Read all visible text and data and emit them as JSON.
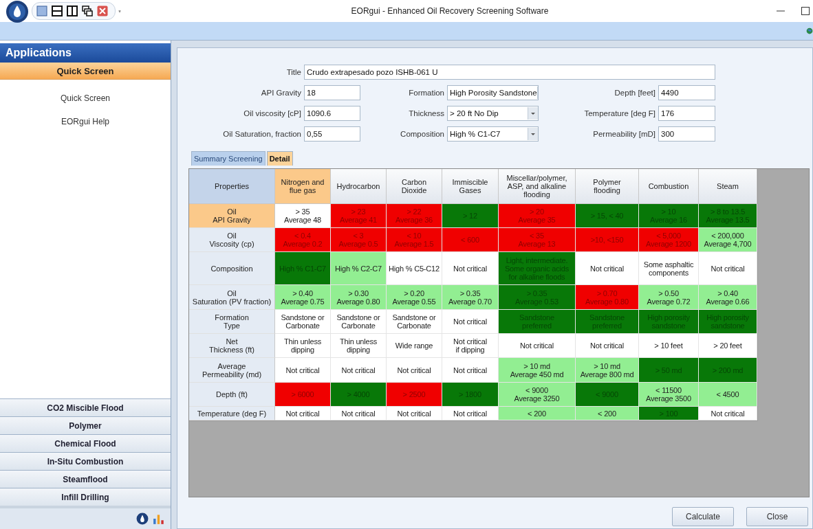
{
  "window": {
    "title": "EORgui - Enhanced Oil Recovery Screening Software"
  },
  "sidebar": {
    "header": "Applications",
    "section": {
      "label": "Quick Screen",
      "selected": true
    },
    "items": [
      "Quick Screen",
      "EORgui Help"
    ],
    "groups": [
      {
        "label": "CO2 Miscible Flood",
        "selected": false
      },
      {
        "label": "Polymer",
        "selected": false
      },
      {
        "label": "Chemical Flood",
        "selected": false
      },
      {
        "label": "In-Situ Combustion",
        "selected": false
      },
      {
        "label": "Steamflood",
        "selected": false
      },
      {
        "label": "Infill Drilling",
        "selected": false
      }
    ]
  },
  "form": {
    "title": {
      "label": "Title",
      "value": "Crudo extrapesado pozo ISHB-061 U"
    },
    "fields": [
      {
        "label": "API Gravity",
        "value": "18",
        "kind": "text"
      },
      {
        "label": "Formation",
        "value": "High Porosity Sandstone",
        "kind": "dropdown"
      },
      {
        "label": "Depth [feet]",
        "value": "4490",
        "kind": "text"
      },
      {
        "label": "Oil viscosity [cP]",
        "value": "1090.6",
        "kind": "text"
      },
      {
        "label": "Thickness",
        "value": "> 20 ft No Dip",
        "kind": "dropdown"
      },
      {
        "label": "Temperature [deg F]",
        "value": "176",
        "kind": "text"
      },
      {
        "label": "Oil Saturation, fraction",
        "value": "0,55",
        "kind": "text"
      },
      {
        "label": "Composition",
        "value": "High % C1-C7",
        "kind": "dropdown"
      },
      {
        "label": "Permeability [mD]",
        "value": "300",
        "kind": "text"
      }
    ]
  },
  "tabs": [
    {
      "label": "Summary Screening",
      "selected": false
    },
    {
      "label": "Detail",
      "selected": true
    }
  ],
  "table": {
    "corner": "Properties",
    "columns": [
      {
        "label": "Nitrogen and\nflue gas",
        "highlighted": true
      },
      {
        "label": "Hydrocarbon",
        "highlighted": false
      },
      {
        "label": "Carbon\nDioxide",
        "highlighted": false
      },
      {
        "label": "Immiscible\nGases",
        "highlighted": false
      },
      {
        "label": "Miscellar/polymer,\nASP, and alkaline\nflooding",
        "highlighted": false
      },
      {
        "label": "Polymer\nflooding",
        "highlighted": false
      },
      {
        "label": "Combustion",
        "highlighted": false
      },
      {
        "label": "Steam",
        "highlighted": false
      }
    ],
    "rows": [
      {
        "label": "Oil\nAPI Gravity",
        "highlighted": true,
        "cells": [
          {
            "text": "> 35\nAverage 48",
            "color": "#ffffff"
          },
          {
            "text": "> 23\nAverage 41",
            "color": "#f00000"
          },
          {
            "text": "> 22\nAverage 36",
            "color": "#f00000"
          },
          {
            "text": "> 12",
            "color": "#087808"
          },
          {
            "text": "> 20\nAverage 35",
            "color": "#f00000"
          },
          {
            "text": "> 15, < 40",
            "color": "#087808"
          },
          {
            "text": "> 10\nAverage 16",
            "color": "#087808"
          },
          {
            "text": "> 8 to 13.5\nAverage 13.5",
            "color": "#087808"
          }
        ]
      },
      {
        "label": "Oil\nViscosity (cp)",
        "highlighted": false,
        "cells": [
          {
            "text": "< 0.4\nAverage 0.2",
            "color": "#f00000"
          },
          {
            "text": "< 3\nAverage 0.5",
            "color": "#f00000"
          },
          {
            "text": "< 10\nAverage 1.5",
            "color": "#f00000"
          },
          {
            "text": "< 600",
            "color": "#f00000"
          },
          {
            "text": "< 35\nAverage 13",
            "color": "#f00000"
          },
          {
            "text": ">10, <150",
            "color": "#f00000"
          },
          {
            "text": "< 5,000\nAverage 1200",
            "color": "#f00000"
          },
          {
            "text": "< 200,000\nAverage 4,700",
            "color": "#92ee92"
          }
        ]
      },
      {
        "label": "Composition",
        "highlighted": false,
        "cells": [
          {
            "text": "High % C1-C7",
            "color": "#087808"
          },
          {
            "text": "High % C2-C7",
            "color": "#92ee92"
          },
          {
            "text": "High % C5-C12",
            "color": "#ffffff"
          },
          {
            "text": "Not critical",
            "color": "#ffffff"
          },
          {
            "text": "Light, intermediate.\nSome organic acids\nfor alkaline floods",
            "color": "#087808"
          },
          {
            "text": "Not critical",
            "color": "#ffffff"
          },
          {
            "text": "Some asphaltic\ncomponents",
            "color": "#ffffff"
          },
          {
            "text": "Not critical",
            "color": "#ffffff"
          }
        ]
      },
      {
        "label": "Oil\nSaturation (PV fraction)",
        "highlighted": false,
        "cells": [
          {
            "text": "> 0.40\nAverage 0.75",
            "color": "#92ee92"
          },
          {
            "text": "> 0.30\nAverage 0.80",
            "color": "#92ee92"
          },
          {
            "text": "> 0.20\nAverage 0.55",
            "color": "#92ee92"
          },
          {
            "text": "> 0.35\nAverage 0.70",
            "color": "#92ee92"
          },
          {
            "text": "> 0.35\nAverage 0.53",
            "color": "#087808"
          },
          {
            "text": "> 0.70\nAverage 0.80",
            "color": "#f00000"
          },
          {
            "text": "> 0.50\nAverage 0.72",
            "color": "#92ee92"
          },
          {
            "text": "> 0.40\nAverage 0.66",
            "color": "#92ee92"
          }
        ]
      },
      {
        "label": "Formation\nType",
        "highlighted": false,
        "cells": [
          {
            "text": "Sandstone or\nCarbonate",
            "color": "#ffffff"
          },
          {
            "text": "Sandstone or\nCarbonate",
            "color": "#ffffff"
          },
          {
            "text": "Sandstone or\nCarbonate",
            "color": "#ffffff"
          },
          {
            "text": "Not critical",
            "color": "#ffffff"
          },
          {
            "text": "Sandstone\npreferred",
            "color": "#087808"
          },
          {
            "text": "Sandstone\npreferred",
            "color": "#087808"
          },
          {
            "text": "High porosity\nsandstone",
            "color": "#087808"
          },
          {
            "text": "High porosity\nsandstone",
            "color": "#087808"
          }
        ]
      },
      {
        "label": "Net\nThickness (ft)",
        "highlighted": false,
        "cells": [
          {
            "text": "Thin unless\ndipping",
            "color": "#ffffff"
          },
          {
            "text": "Thin unless\ndipping",
            "color": "#ffffff"
          },
          {
            "text": "Wide range",
            "color": "#ffffff"
          },
          {
            "text": "Not critical\nif dipping",
            "color": "#ffffff"
          },
          {
            "text": "Not critical",
            "color": "#ffffff"
          },
          {
            "text": "Not critical",
            "color": "#ffffff"
          },
          {
            "text": "> 10 feet",
            "color": "#ffffff"
          },
          {
            "text": "> 20 feet",
            "color": "#ffffff"
          }
        ]
      },
      {
        "label": "Average\nPermeability (md)",
        "highlighted": false,
        "cells": [
          {
            "text": "Not critical",
            "color": "#ffffff"
          },
          {
            "text": "Not critical",
            "color": "#ffffff"
          },
          {
            "text": "Not critical",
            "color": "#ffffff"
          },
          {
            "text": "Not critical",
            "color": "#ffffff"
          },
          {
            "text": "> 10 md\nAverage 450 md",
            "color": "#92ee92"
          },
          {
            "text": "> 10 md\nAverage 800 md",
            "color": "#92ee92"
          },
          {
            "text": "> 50 md",
            "color": "#087808"
          },
          {
            "text": "> 200 md",
            "color": "#087808"
          }
        ]
      },
      {
        "label": "Depth (ft)",
        "highlighted": false,
        "cells": [
          {
            "text": "> 6000",
            "color": "#f00000"
          },
          {
            "text": "> 4000",
            "color": "#087808"
          },
          {
            "text": "> 2500",
            "color": "#f00000"
          },
          {
            "text": "> 1800",
            "color": "#087808"
          },
          {
            "text": "< 9000\nAverage 3250",
            "color": "#92ee92"
          },
          {
            "text": "< 9000",
            "color": "#087808"
          },
          {
            "text": "< 11500\nAverage 3500",
            "color": "#92ee92"
          },
          {
            "text": "< 4500",
            "color": "#92ee92"
          }
        ]
      },
      {
        "label": "Temperature (deg F)",
        "highlighted": false,
        "cells": [
          {
            "text": "Not critical",
            "color": "#ffffff"
          },
          {
            "text": "Not critical",
            "color": "#ffffff"
          },
          {
            "text": "Not critical",
            "color": "#ffffff"
          },
          {
            "text": "Not critical",
            "color": "#ffffff"
          },
          {
            "text": "< 200",
            "color": "#92ee92"
          },
          {
            "text": "< 200",
            "color": "#92ee92"
          },
          {
            "text": "> 100",
            "color": "#087808"
          },
          {
            "text": "Not critical",
            "color": "#ffffff"
          }
        ]
      }
    ]
  },
  "buttons": [
    "Calculate",
    "Close"
  ]
}
